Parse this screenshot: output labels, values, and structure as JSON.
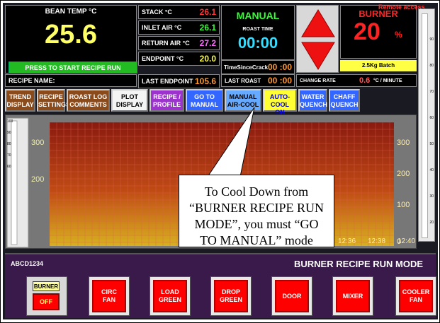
{
  "bean_temp": {
    "label": "BEAN TEMP °C",
    "value": "25.6",
    "start_button": "PRESS TO START RECIPE RUN"
  },
  "recipe": {
    "label": "RECIPE NAME:"
  },
  "readings": [
    {
      "label": "STACK °C",
      "value": "26.1",
      "color": "#ff3333"
    },
    {
      "label": "INLET AIR °C",
      "value": "26.1",
      "color": "#33ff33"
    },
    {
      "label": "RETURN AIR °C",
      "value": "27.2",
      "color": "#ff66ff"
    },
    {
      "label": "ENDPOINT °C",
      "value": "20.0",
      "color": "#ffff33"
    },
    {
      "label": "LAST ENDPOINT",
      "value": "105.6",
      "color": "#ff9933"
    }
  ],
  "mode": {
    "name": "MANUAL",
    "roast_time_label": "ROAST TIME",
    "roast_time": "00:00"
  },
  "time_since_crack": {
    "label": "TimeSinceCrack",
    "value": "00 :00"
  },
  "last_roast": {
    "label": "LAST ROAST",
    "value": "00 :00"
  },
  "burner": {
    "label": "BURNER",
    "value": "20",
    "unit": "%",
    "batch": "2.5Kg Batch",
    "remote": "Remote access"
  },
  "change_rate": {
    "label": "CHANGE RATE",
    "value": "0.6",
    "unit": "°C / MINUTE"
  },
  "toolbar": [
    {
      "name": "trend-display-button",
      "label": "TREND\nDISPLAY",
      "style": "b-brown"
    },
    {
      "name": "recipe-settings-button",
      "label": "RECIPE\nSETTINGS",
      "style": "b-brown"
    },
    {
      "name": "roast-log-comments-button",
      "label": "ROAST LOG\nCOMMENTS",
      "style": "b-brown"
    },
    {
      "name": "plot-display-button",
      "label": "PLOT\nDISPLAY",
      "style": "b-white"
    },
    {
      "name": "recipe-profile-button",
      "label": "RECIPE /\nPROFILE",
      "style": "b-purple"
    },
    {
      "name": "go-to-manual-button",
      "label": "GO TO\nMANUAL",
      "style": "b-blue"
    },
    {
      "name": "manual-air-cool-button",
      "label": "MANUAL\nAIR-COOL",
      "style": "b-lblue"
    },
    {
      "name": "auto-cool-on-button",
      "label": "AUTO-COOL\nON",
      "style": "b-yellow"
    },
    {
      "name": "water-quench-button",
      "label": "WATER\nQUENCH",
      "style": "b-blue"
    },
    {
      "name": "chaff-quench-button",
      "label": "CHAFF\nQUENCH",
      "style": "b-blue"
    }
  ],
  "chart": {
    "left_ticks": [
      "300",
      "200"
    ],
    "right_ticks": [
      "300",
      "200",
      "100",
      "0"
    ],
    "time_ticks": [
      "12:36",
      "12:38",
      "12:40"
    ],
    "mini_ticks": [
      "100",
      "90",
      "80",
      "70",
      "60"
    ]
  },
  "scale_ticks": [
    "90",
    "80",
    "70",
    "60",
    "50",
    "40",
    "30",
    "20"
  ],
  "callout": {
    "text": "To Cool Down from “BURNER RECIPE RUN MODE”, you must “GO TO MANUAL” mode"
  },
  "bottom": {
    "code": "ABCD1234",
    "title": "BURNER RECIPE RUN MODE",
    "burner_switch": {
      "label": "BURNER",
      "state": "OFF"
    },
    "buttons": [
      {
        "name": "circ-fan-button",
        "label": "CIRC\nFAN"
      },
      {
        "name": "load-green-button",
        "label": "LOAD\nGREEN"
      },
      {
        "name": "drop-green-button",
        "label": "DROP\nGREEN"
      },
      {
        "name": "door-button",
        "label": "DOOR"
      },
      {
        "name": "mixer-button",
        "label": "MIXER"
      },
      {
        "name": "cooler-fan-button",
        "label": "COOLER\nFAN"
      }
    ]
  }
}
